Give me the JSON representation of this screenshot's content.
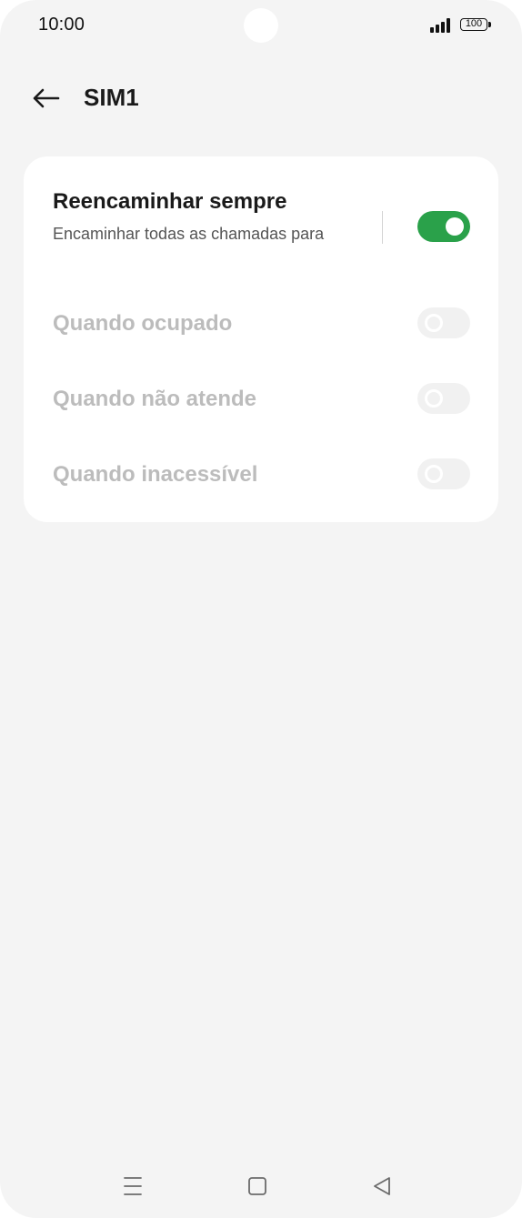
{
  "status_bar": {
    "time": "10:00",
    "battery_level": "100",
    "signal_bars": 4
  },
  "header": {
    "back_icon": "arrow-left-icon",
    "title": "SIM1"
  },
  "settings": {
    "forward_always": {
      "title": "Reencaminhar sempre",
      "subtitle": "Encaminhar todas as chamadas para",
      "enabled": true
    },
    "items": [
      {
        "label": "Quando ocupado",
        "enabled": false,
        "disabled": true
      },
      {
        "label": "Quando não atende",
        "enabled": false,
        "disabled": true
      },
      {
        "label": "Quando inacessível",
        "enabled": false,
        "disabled": true
      }
    ]
  },
  "nav_bar": {
    "icons": [
      "menu-icon",
      "home-icon",
      "back-triangle-icon"
    ]
  },
  "colors": {
    "toggle_on": "#2aa14a",
    "toggle_off": "#f1f1f1",
    "background": "#f4f4f4",
    "card": "#ffffff",
    "disabled_text": "#bcbcbc"
  }
}
